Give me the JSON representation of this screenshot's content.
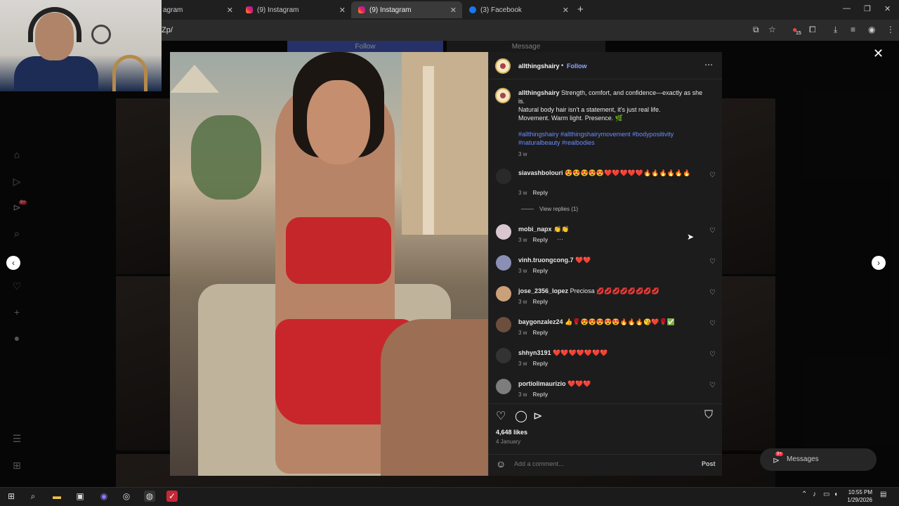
{
  "browser": {
    "tabs": [
      {
        "title": "agram",
        "icon": "instagram-icon",
        "active": false
      },
      {
        "title": "(9) Instagram",
        "icon": "instagram-icon",
        "active": false
      },
      {
        "title": "(9) Instagram",
        "icon": "instagram-icon",
        "active": true
      },
      {
        "title": "(3) Facebook",
        "icon": "facebook-icon",
        "active": false
      }
    ],
    "url": "Zp/",
    "extension_badge": "15"
  },
  "background_page": {
    "follow_label": "Follow",
    "message_label": "Message",
    "notification_badge": "9+"
  },
  "post": {
    "author": "allthingshairy",
    "follow_label": "Follow",
    "caption_line1": "Strength, comfort, and confidence—exactly as she is.",
    "caption_line2": "Natural body hair isn't a statement, it's just real life.",
    "caption_line3": "Movement. Warm light. Presence. 🌿",
    "hashtags": "#allthingshairy #allthingshairymovement #bodypositivity #naturalbeauty #realbodies",
    "caption_age": "3 w",
    "likes": "4,648 likes",
    "date": "4 January",
    "add_comment_placeholder": "Add a comment...",
    "post_label": "Post"
  },
  "comments": [
    {
      "user": "siavashbolouri",
      "text": "😍😍😍😍😍❤️❤️❤️❤️❤️🔥🔥🔥🔥🔥🔥",
      "age": "3 w",
      "reply": "Reply",
      "view_replies": "View replies (1)"
    },
    {
      "user": "mobi_napx",
      "text": "👏👏",
      "age": "3 w",
      "reply": "Reply"
    },
    {
      "user": "vinh.truongcong.7",
      "text": "❤️❤️",
      "age": "3 w",
      "reply": "Reply"
    },
    {
      "user": "jose_2356_lopez",
      "text": "Preciosa 💋💋💋💋💋💋💋💋",
      "age": "3 w",
      "reply": "Reply"
    },
    {
      "user": "baygonzalez24",
      "text": "👍🌹😍😍😍😍😍🔥🔥🔥😘❤️🌹✅",
      "age": "3 w",
      "reply": "Reply"
    },
    {
      "user": "shhyn3191",
      "text": "❤️❤️❤️❤️❤️❤️❤️",
      "age": "3 w",
      "reply": "Reply"
    },
    {
      "user": "portiolimaurizio",
      "text": "❤️❤️❤️",
      "age": "3 w",
      "reply": "Reply"
    }
  ],
  "messages_pill": {
    "label": "Messages",
    "badge": "9+"
  },
  "taskbar": {
    "time": "10:55 PM",
    "date": "1/29/2026"
  }
}
